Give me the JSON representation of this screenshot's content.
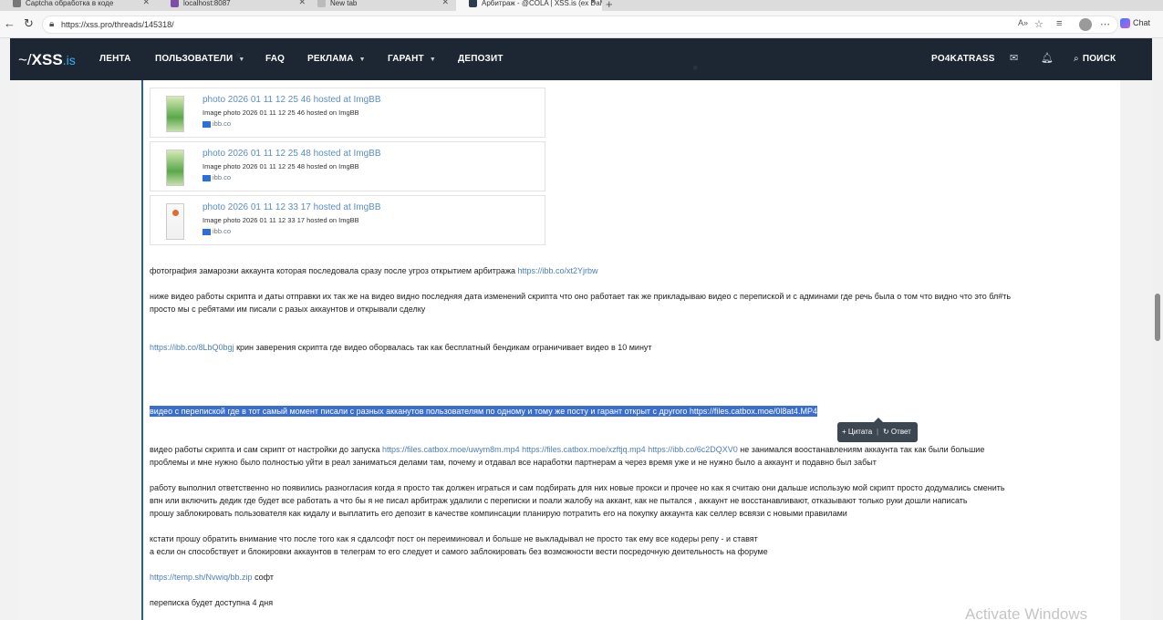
{
  "browser": {
    "tabs": [
      {
        "label": "Captcha обработка в коде"
      },
      {
        "label": "localhost:8087"
      },
      {
        "label": "New tab"
      },
      {
        "label": "Арбитраж - @COLA | XSS.is (ex DaMaGeLaB)"
      }
    ],
    "url": "https://xss.pro/threads/145318/",
    "chat_label": "Chat"
  },
  "site": {
    "logo_prefix": "~/",
    "logo_name": "XSS",
    "logo_domain": ".is",
    "nav": [
      {
        "label": "ЛЕНТА"
      },
      {
        "label": "ПОЛЬЗОВАТЕЛИ"
      },
      {
        "label": "FAQ"
      },
      {
        "label": "РЕКЛАМА"
      },
      {
        "label": "ГАРАНТ"
      },
      {
        "label": "ДЕПОЗИТ"
      }
    ],
    "username": "PO4KATRASS",
    "search_label": "ПОИСК"
  },
  "post": {
    "embeds": [
      {
        "title": "photo 2026 01 11 12 25 46 hosted at ImgBB",
        "desc": "Image photo 2026 01 11 12 25 46 hosted on ImgBB",
        "source": "ibb.co"
      },
      {
        "title": "photo 2026 01 11 12 25 48 hosted at ImgBB",
        "desc": "Image photo 2026 01 11 12 25 48 hosted on ImgBB",
        "source": "ibb.co"
      },
      {
        "title": "photo 2026 01 11 12 33 17 hosted at ImgBB",
        "desc": "Image photo 2026 01 11 12 33 17 hosted on ImgBB",
        "source": "ibb.co"
      }
    ],
    "p1_text": "фотография замарозки аккаунта которая последовала сразу после угроз открытием арбитража ",
    "p1_link": "https://ibb.co/xt2Yjrbw",
    "p2_line1": "ниже видео работы скрипта и даты отправки их так же на видео видно последняя дата изменений скрипта что оно работает так же прикладываю видео с перепиской и с админами где речь была о том что видно что это бл#ть",
    "p2_line2": "просто мы с ребятами им писали с разых аккаунтов и открывали сделку",
    "p3_link": "https://ibb.co/8LbQ0bgj",
    "p3_text": " крин заверения скрипта где видео оборвалась так как бесплатный бендикам ограничивает видео в 10 минут",
    "p4_text": "видео с перепиской где в тот самый момент писали с разных акканутов пользователям по одному и тому же посту и гарант открыт с другого ",
    "p4_link": "https://files.catbox.moe/0l8at4.MP4",
    "popup_quote": "+ Цитата",
    "popup_sep": "|",
    "popup_reply": "↻ Ответ",
    "p5_text1": "видео работы скрипта и сам скрипт от настройки до запуска ",
    "p5_link1": "https://files.catbox.moe/uwym8m.mp4",
    "p5_link2": "https://files.catbox.moe/xzftjq.mp4",
    "p5_link3": "https://ibb.co/6c2DQXV0",
    "p5_text2": " не занимался воостанавлениям аккаунта так как были большие",
    "p5_line2": "проблемы и мне нужно было полностью уйти в реал заниматься делами там, почему и отдавал все наработки партнерам а через время уже и не нужно было а аккаунт и подавно был забыт",
    "p6_line1": "работу выполнил ответственно но появились разногласия когда я просто так должен играться и сам подбирать для них новые прокси и прочее но как я считаю они дальше использую мой скрипт просто додумались сменить",
    "p6_line2": "впн или включить дедик где будет все работать а что бы я не писал арбитраж удалили с переписки и поали жалобу на аккант, как не пытался , аккаунт не восстанавливают, отказывают только руки дошли написать",
    "p6_line3": "прошу заблокировать пользователя как кидалу и выплатить его депозит в качестве компинсации планирую потратить его на покупку аккаунта как селлер всвязи с новыми правилами",
    "p7_line1": "кстати прошу обратить внимание что после того как я сдалсофт пост он переиминовал и больше не выкладывал не просто так ему все кодеры репу - и ставят",
    "p7_line2": "а если он способствует и блокировки аккаунтов в телеграм то его следует и самого заблокировать без возможности вести посредочную деительность на форуме",
    "p8_link": "https://temp.sh/Nvwiq/bb.zip",
    "p8_text": " софт",
    "p9_text": "переписка будет доступна 4 дня"
  },
  "watermark": "Activate Windows"
}
